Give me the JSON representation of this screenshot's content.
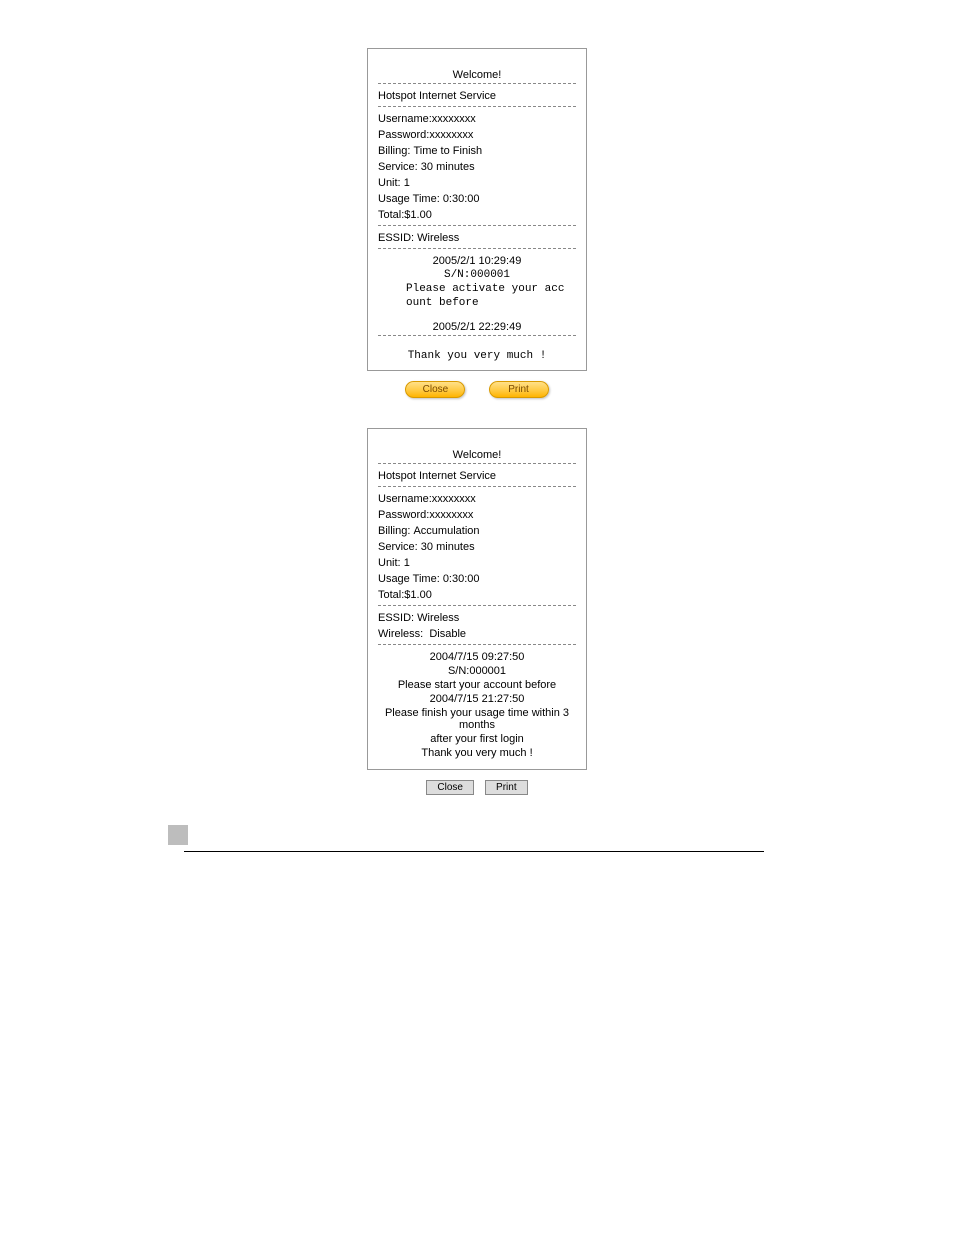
{
  "receipt1": {
    "title": "Welcome!",
    "service_line": "Hotspot Internet Service",
    "rows": {
      "username_label": "Username:",
      "username_value": "xxxxxxxx",
      "password_label": "Password:",
      "password_value": "xxxxxxxx",
      "billing_label": "Billing: ",
      "billing_value": "Time to Finish",
      "service_label": "Service: ",
      "service_value": "30 minutes",
      "unit_label": "Unit: ",
      "unit_value": "1",
      "usage_label": "Usage Time: ",
      "usage_value": "0:30:00",
      "total_label": "Total:",
      "total_value": "$1.00"
    },
    "essid_label": "ESSID: ",
    "essid_value": "Wireless",
    "footer": {
      "ts1": "2005/2/1 10:29:49",
      "sn": "S/N:000001",
      "activate1": "Please activate your acc",
      "activate2": "ount before",
      "ts2": "2005/2/1 22:29:49",
      "thanks": "Thank you very much !"
    },
    "buttons": {
      "close": "Close",
      "print": "Print"
    }
  },
  "receipt2": {
    "title": "Welcome!",
    "service_line": "Hotspot Internet Service",
    "rows": {
      "username_label": "Username:",
      "username_value": "xxxxxxxx",
      "password_label": "Password:",
      "password_value": "xxxxxxxx",
      "billing_label": "Billing: ",
      "billing_value": "Accumulation",
      "service_label": "Service: ",
      "service_value": "30 minutes",
      "unit_label": "Unit: ",
      "unit_value": "1",
      "usage_label": "Usage Time: ",
      "usage_value": "0:30:00",
      "total_label": "Total:",
      "total_value": "$1.00"
    },
    "essid_label": "ESSID: ",
    "essid_value": "Wireless",
    "wireless_label": "Wireless:  ",
    "wireless_value": "Disable",
    "footer": {
      "ts1": "2004/7/15 09:27:50",
      "sn": "S/N:000001",
      "start_before": "Please start your account before",
      "ts2": "2004/7/15 21:27:50",
      "finish1": "Please finish your usage time within 3 months",
      "finish2": "after your first login",
      "thanks": "Thank you very much !"
    },
    "buttons": {
      "close": "Close",
      "print": "Print"
    }
  }
}
